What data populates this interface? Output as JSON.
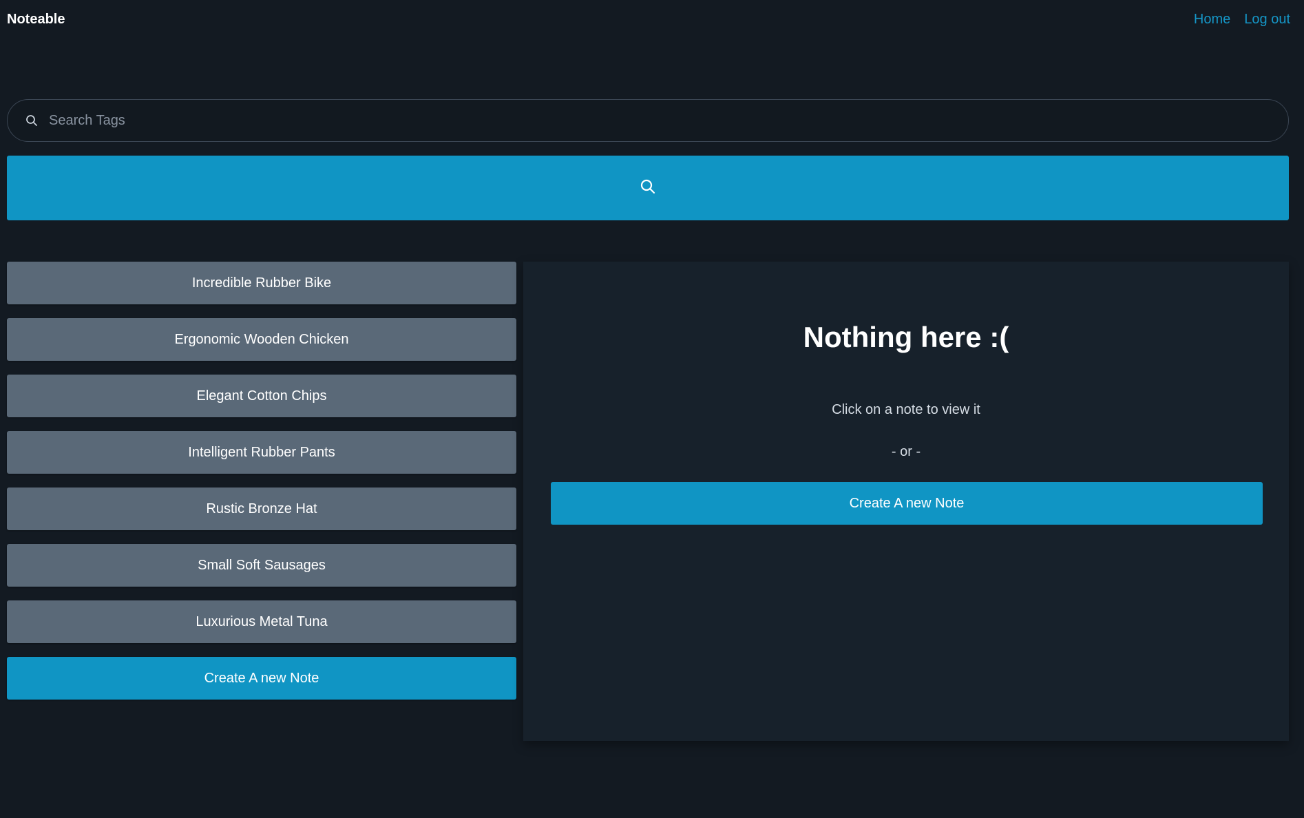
{
  "app": {
    "brand": "Noteable"
  },
  "nav": {
    "home": "Home",
    "logout": "Log out"
  },
  "search": {
    "placeholder": "Search Tags",
    "value": "",
    "input_icon": "search-icon",
    "button_icon": "search-icon"
  },
  "notes": [
    {
      "title": "Incredible Rubber Bike"
    },
    {
      "title": "Ergonomic Wooden Chicken"
    },
    {
      "title": "Elegant Cotton Chips"
    },
    {
      "title": "Intelligent Rubber Pants"
    },
    {
      "title": "Rustic Bronze Hat"
    },
    {
      "title": "Small Soft Sausages"
    },
    {
      "title": "Luxurious Metal Tuna"
    }
  ],
  "list": {
    "create_label": "Create A new Note"
  },
  "panel": {
    "title": "Nothing here :(",
    "hint": "Click on a note to view it",
    "or": "- or -",
    "create_label": "Create A new Note"
  },
  "colors": {
    "background": "#131a22",
    "panel": "#17212b",
    "accent": "#1095c4",
    "note_item": "#5a6978",
    "link": "#1597c8"
  }
}
